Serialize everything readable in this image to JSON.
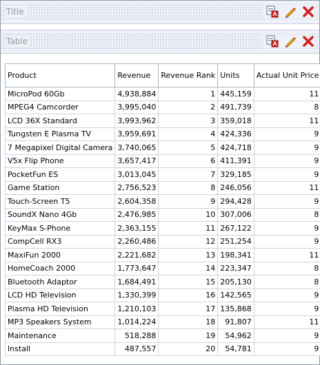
{
  "panes": {
    "title_pane": {
      "label": "Title"
    },
    "table_pane": {
      "label": "Table"
    }
  },
  "icons": [
    "export-icon",
    "edit-pencil-icon",
    "delete-x-icon"
  ],
  "colors": {
    "accent_red": "#cc2222",
    "header_bg": "#eef1f8",
    "border": "#8d98a8"
  },
  "table": {
    "columns": [
      "Product",
      "Revenue",
      "Revenue Rank",
      "Units",
      "Actual Unit Price"
    ],
    "rows": [
      [
        "MicroPod 60Gb",
        "4,938,884",
        "1",
        "445,159",
        "11"
      ],
      [
        "MPEG4 Camcorder",
        "3,995,040",
        "2",
        "491,739",
        "8"
      ],
      [
        "LCD 36X Standard",
        "3,993,962",
        "3",
        "359,018",
        "11"
      ],
      [
        "Tungsten E Plasma TV",
        "3,959,691",
        "4",
        "424,336",
        "9"
      ],
      [
        "7 Megapixel Digital Camera",
        "3,740,065",
        "5",
        "424,718",
        "9"
      ],
      [
        "V5x Flip Phone",
        "3,657,417",
        "6",
        "411,391",
        "9"
      ],
      [
        "PocketFun ES",
        "3,013,045",
        "7",
        "329,185",
        "9"
      ],
      [
        "Game Station",
        "2,756,523",
        "8",
        "246,056",
        "11"
      ],
      [
        "Touch-Screen T5",
        "2,604,358",
        "9",
        "294,428",
        "9"
      ],
      [
        "SoundX Nano 4Gb",
        "2,476,985",
        "10",
        "307,006",
        "8"
      ],
      [
        "KeyMax S-Phone",
        "2,363,155",
        "11",
        "267,122",
        "9"
      ],
      [
        "CompCell RX3",
        "2,260,486",
        "12",
        "251,254",
        "9"
      ],
      [
        "MaxiFun 2000",
        "2,221,682",
        "13",
        "198,341",
        "11"
      ],
      [
        "HomeCoach 2000",
        "1,773,647",
        "14",
        "223,347",
        "8"
      ],
      [
        "Bluetooth Adaptor",
        "1,684,491",
        "15",
        "205,130",
        "8"
      ],
      [
        "LCD HD Television",
        "1,330,399",
        "16",
        "142,565",
        "9"
      ],
      [
        "Plasma HD Television",
        "1,210,103",
        "17",
        "135,868",
        "9"
      ],
      [
        "MP3 Speakers System",
        "1,014,224",
        "18",
        "91,807",
        "11"
      ],
      [
        "Maintenance",
        "518,288",
        "19",
        "54,962",
        "9"
      ],
      [
        "Install",
        "487,557",
        "20",
        "54,781",
        "9"
      ]
    ]
  }
}
